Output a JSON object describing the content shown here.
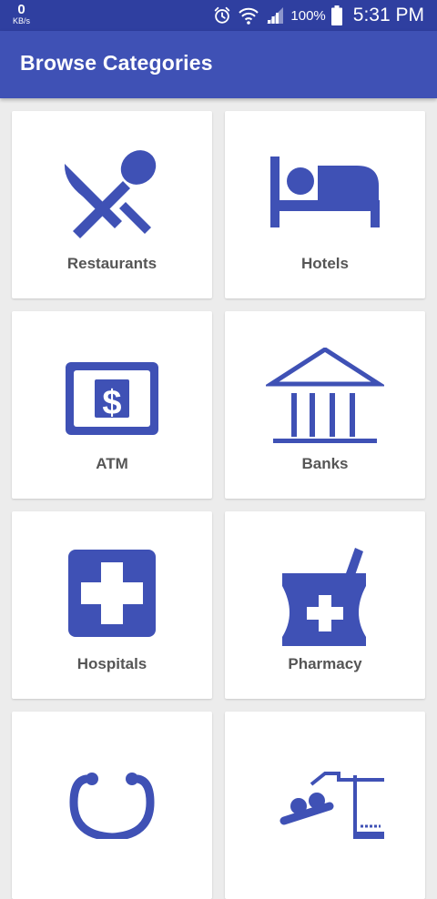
{
  "status_bar": {
    "net_speed_value": "0",
    "net_speed_unit": "KB/s",
    "battery_percent": "100%",
    "time": "5:31 PM",
    "icons": [
      "alarm-icon",
      "wifi-icon",
      "signal-icon",
      "battery-icon"
    ]
  },
  "app_bar": {
    "title": "Browse Categories"
  },
  "colors": {
    "primary": "#3f51b5",
    "primary_dark": "#2f3fa0",
    "icon": "#3f51b5",
    "label": "#555555",
    "background": "#ececec"
  },
  "categories": [
    {
      "label": "Restaurants",
      "icon": "restaurant-icon"
    },
    {
      "label": "Hotels",
      "icon": "hotel-icon"
    },
    {
      "label": "ATM",
      "icon": "atm-icon"
    },
    {
      "label": "Banks",
      "icon": "bank-icon"
    },
    {
      "label": "Hospitals",
      "icon": "hospital-icon"
    },
    {
      "label": "Pharmacy",
      "icon": "pharmacy-icon"
    },
    {
      "label": "",
      "icon": "stethoscope-icon"
    },
    {
      "label": "",
      "icon": "fitness-icon"
    }
  ]
}
